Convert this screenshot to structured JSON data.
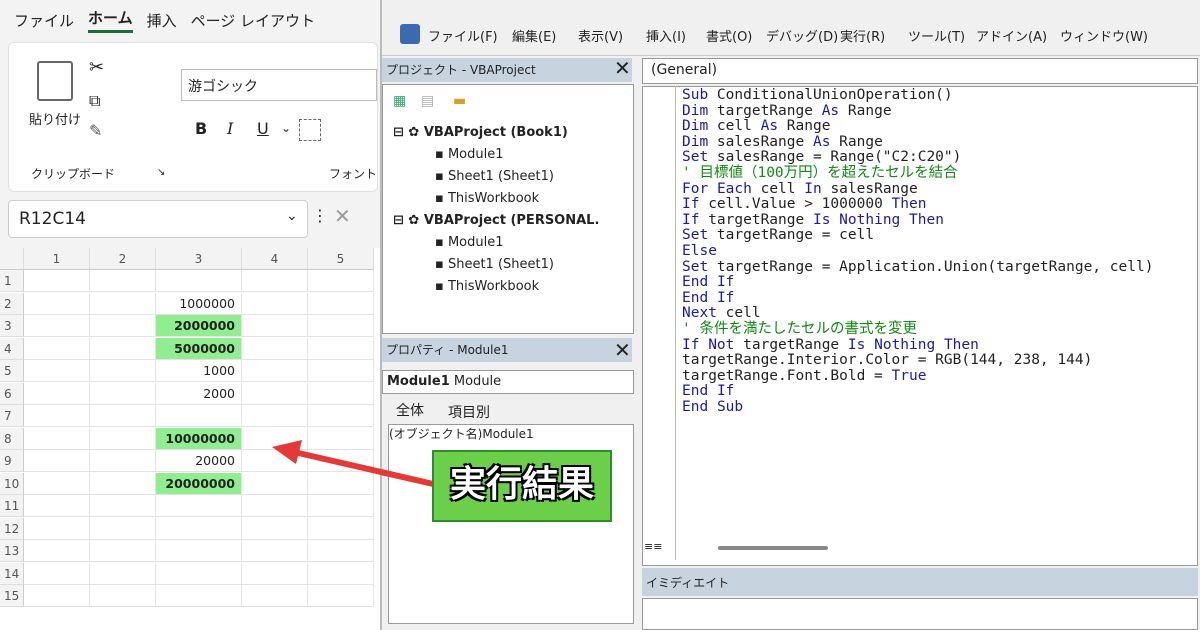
{
  "excel": {
    "tabs": [
      "ファイル",
      "ホーム",
      "挿入",
      "ページ レイアウト"
    ],
    "active_tab": "ホーム",
    "clipboard": {
      "paste_label": "貼り付け",
      "group_label": "クリップボード"
    },
    "font": {
      "font_name": "游ゴシック",
      "bold": "B",
      "italic": "I",
      "underline": "U",
      "group_label": "フォント"
    },
    "name_box": "R12C14",
    "column_headers": [
      "1",
      "2",
      "3",
      "4",
      "5"
    ],
    "row_headers": [
      "1",
      "2",
      "3",
      "4",
      "5",
      "6",
      "7",
      "8",
      "9",
      "10",
      "11",
      "12",
      "13",
      "14",
      "15"
    ],
    "column3_values": [
      "",
      "1000000",
      "2000000",
      "5000000",
      "1000",
      "2000",
      "",
      "10000000",
      "20000",
      "20000000",
      "",
      "",
      "",
      "",
      ""
    ],
    "highlighted_rows": [
      3,
      4,
      8,
      10
    ],
    "highlight_color": "#90ee90"
  },
  "vbe": {
    "menu": [
      "ファイル(F)",
      "編集(E)",
      "表示(V)",
      "挿入(I)",
      "書式(O)",
      "デバッグ(D)",
      "実行(R)",
      "ツール(T)",
      "アドイン(A)",
      "ウィンドウ(W)"
    ],
    "project_panel": {
      "title": "プロジェクト - VBAProject",
      "tree": [
        {
          "label": "VBAProject (Book1)",
          "level": 0
        },
        {
          "label": "Module1",
          "level": 1
        },
        {
          "label": "Sheet1 (Sheet1)",
          "level": 1
        },
        {
          "label": "ThisWorkbook",
          "level": 1
        },
        {
          "label": "VBAProject (PERSONAL.",
          "level": 0
        },
        {
          "label": "Module1",
          "level": 1
        },
        {
          "label": "Sheet1 (Sheet1)",
          "level": 1
        },
        {
          "label": "ThisWorkbook",
          "level": 1
        }
      ]
    },
    "properties_panel": {
      "title": "プロパティ - Module1",
      "object_select_bold": "Module1",
      "object_select_type": "Module",
      "tabs": [
        "全体",
        "項目別"
      ],
      "row_label": "(オブジェクト名)",
      "row_value": "Module1"
    },
    "code_dropdown": "(General)",
    "code_lines": [
      "Sub ConditionalUnionOperation()",
      "Dim targetRange As Range",
      "Dim cell As Range",
      "Dim salesRange As Range",
      "Set salesRange = Range(\"C2:C20\")",
      "' 目標値（100万円）を超えたセルを結合",
      "For Each cell In salesRange",
      "If cell.Value > 1000000 Then",
      "If targetRange Is Nothing Then",
      "Set targetRange = cell",
      "Else",
      "Set targetRange = Application.Union(targetRange, cell)",
      "End If",
      "End If",
      "Next cell",
      "' 条件を満たしたセルの書式を変更",
      "If Not targetRange Is Nothing Then",
      "targetRange.Interior.Color = RGB(144, 238, 144)",
      "targetRange.Font.Bold = True",
      "End If",
      "End Sub"
    ],
    "immediate_title": "イミディエイト"
  },
  "annotation": {
    "label": "実行結果",
    "arrow_color": "#e53935"
  }
}
